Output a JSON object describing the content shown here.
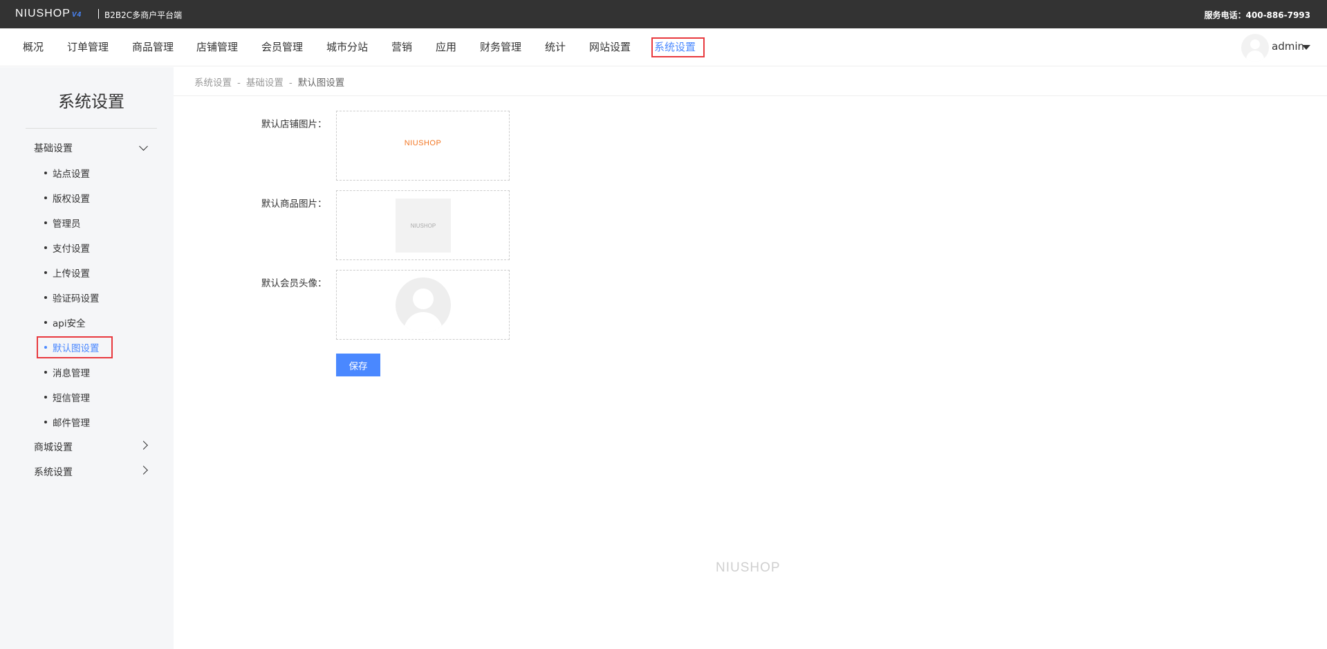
{
  "topbar": {
    "logo_text": "NIUSHOP",
    "logo_version": "V4",
    "platform": "B2B2C多商户平台端",
    "hotline": "服务电话：400-886-7993"
  },
  "nav": {
    "items": [
      {
        "label": "概况"
      },
      {
        "label": "订单管理"
      },
      {
        "label": "商品管理"
      },
      {
        "label": "店铺管理"
      },
      {
        "label": "会员管理"
      },
      {
        "label": "城市分站"
      },
      {
        "label": "营销"
      },
      {
        "label": "应用"
      },
      {
        "label": "财务管理"
      },
      {
        "label": "统计"
      },
      {
        "label": "网站设置"
      },
      {
        "label": "系统设置"
      }
    ],
    "active": "系统设置",
    "user": "admin"
  },
  "sidebar": {
    "title": "系统设置",
    "groups": [
      {
        "label": "基础设置",
        "expanded": true,
        "items": [
          {
            "label": "站点设置"
          },
          {
            "label": "版权设置"
          },
          {
            "label": "管理员"
          },
          {
            "label": "支付设置"
          },
          {
            "label": "上传设置"
          },
          {
            "label": "验证码设置"
          },
          {
            "label": "api安全"
          },
          {
            "label": "默认图设置"
          },
          {
            "label": "消息管理"
          },
          {
            "label": "短信管理"
          },
          {
            "label": "邮件管理"
          }
        ]
      },
      {
        "label": "商城设置",
        "expanded": false
      },
      {
        "label": "系统设置",
        "expanded": false
      }
    ],
    "active_item": "默认图设置"
  },
  "breadcrumb": {
    "items": [
      "系统设置",
      "基础设置",
      "默认图设置"
    ],
    "separator": "-"
  },
  "form": {
    "store_label": "默认店铺图片：",
    "store_logo_text": "NIUSHOP",
    "goods_label": "默认商品图片：",
    "goods_placeholder_text": "NIUSHOP",
    "member_label": "默认会员头像：",
    "save_label": "保存"
  },
  "footer": {
    "logo_text": "NIUSHOP"
  },
  "colors": {
    "accent": "#4a88ff",
    "highlight_border": "#e8383d",
    "topbar_bg": "#333333",
    "sidebar_bg": "#f5f6f8",
    "store_logo": "#f27623"
  }
}
